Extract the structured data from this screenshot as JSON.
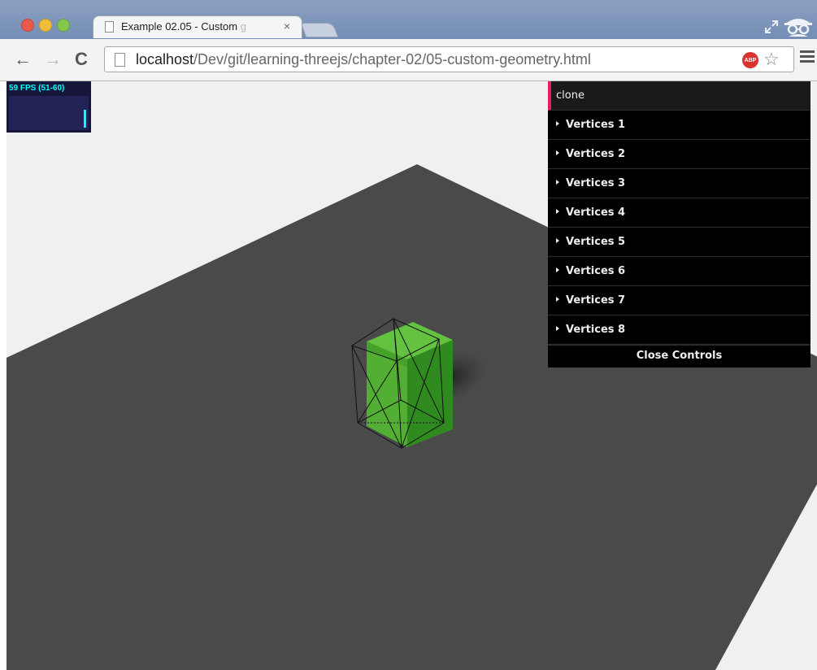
{
  "browser": {
    "tab_title_visible": "Example 02.05 - Custom ",
    "tab_title_faded": "g",
    "tab_close": "×",
    "url_host": "localhost",
    "url_path": "/Dev/git/learning-threejs/chapter-02/05-custom-geometry.html",
    "back": "←",
    "forward": "→",
    "reload": "C",
    "adblock_label": "ABP",
    "bookmark_star": "☆"
  },
  "stats": {
    "fps_text": "59 FPS (51-60)"
  },
  "gui": {
    "clone_label": "clone",
    "folders": [
      "Vertices 1",
      "Vertices 2",
      "Vertices 3",
      "Vertices 4",
      "Vertices 5",
      "Vertices 6",
      "Vertices 7",
      "Vertices 8"
    ],
    "close_label": "Close Controls"
  },
  "colors": {
    "plane": "#4a4a4a",
    "cube": "#4caf2e",
    "gui_bg": "#000000",
    "gui_accent": "#e61d5f",
    "fps_text": "#00ffff"
  }
}
